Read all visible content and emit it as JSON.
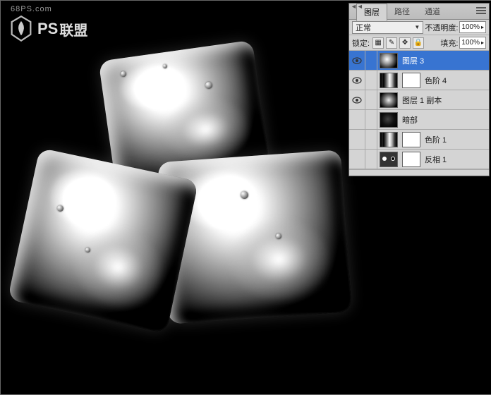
{
  "watermark": {
    "url": "68PS.com",
    "brand_en": "PS",
    "brand_cn": "联盟"
  },
  "panel": {
    "tabs": [
      "图层",
      "路径",
      "通道"
    ],
    "active_tab": 0,
    "blend_mode": "正常",
    "opacity_label": "不透明度:",
    "opacity_value": "100%",
    "lock_label": "锁定:",
    "fill_label": "填充:",
    "fill_value": "100%",
    "layers": [
      {
        "visible": true,
        "name": "图层 3",
        "thumb": "ice-t",
        "selected": true
      },
      {
        "visible": true,
        "name": "色阶 4",
        "thumb": "hist",
        "mask": true
      },
      {
        "visible": true,
        "name": "图层 1 副本",
        "thumb": "ice-t2"
      },
      {
        "visible": false,
        "name": "暗部",
        "thumb": "dark"
      },
      {
        "visible": false,
        "name": "色阶 1",
        "thumb": "hist",
        "mask": true
      },
      {
        "visible": false,
        "name": "反相 1",
        "thumb": "inv",
        "mask": true
      }
    ]
  }
}
